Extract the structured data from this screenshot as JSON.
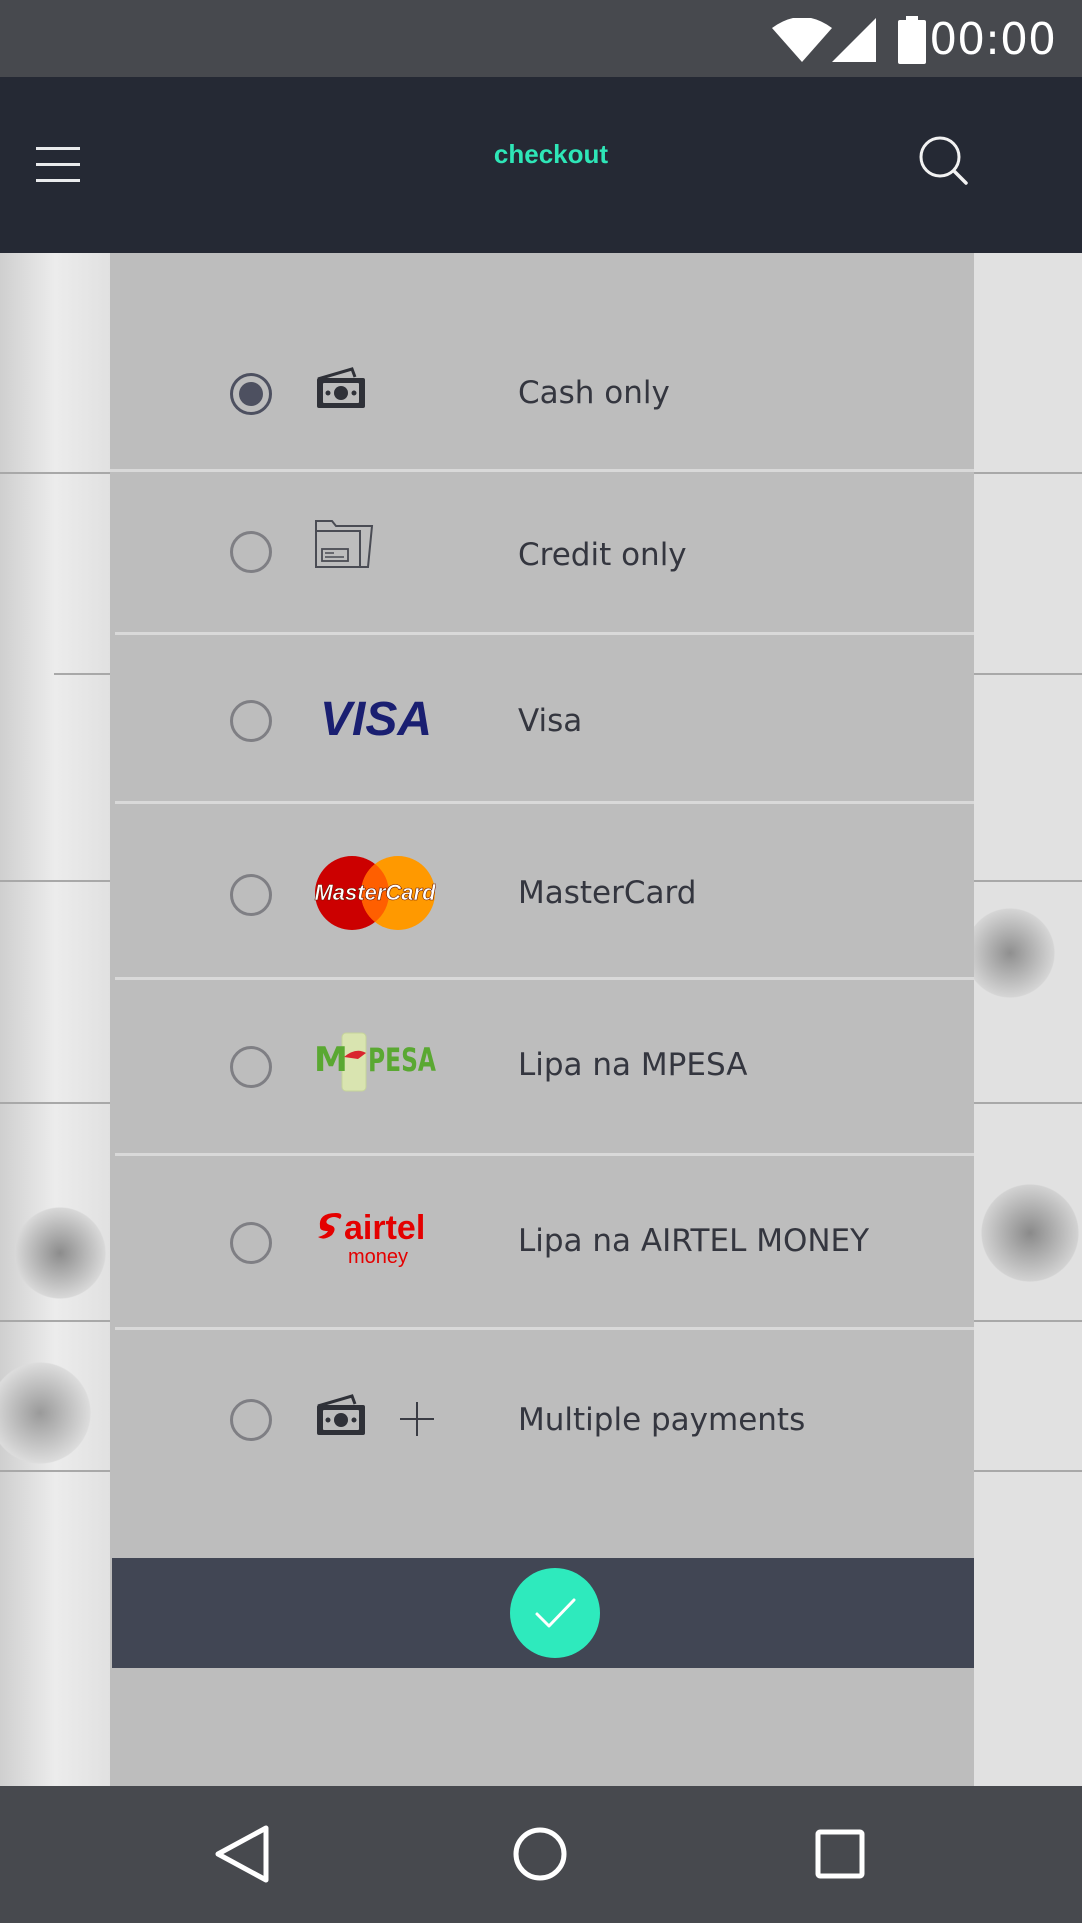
{
  "status_bar": {
    "time": "00:00",
    "icons": [
      "wifi-icon",
      "signal-icon",
      "battery-icon"
    ]
  },
  "app_bar": {
    "title": "checkout",
    "menu_icon": "hamburger-menu-icon",
    "search_icon": "search-icon",
    "title_color": "#2ee6b7"
  },
  "payment_options": [
    {
      "label": "Cash only",
      "icon": "cash-icon",
      "selected": true
    },
    {
      "label": "Credit only",
      "icon": "credit-folder-icon",
      "selected": false
    },
    {
      "label": "Visa",
      "icon": "visa-logo",
      "logo_text": "VISA",
      "selected": false
    },
    {
      "label": "MasterCard",
      "icon": "mastercard-logo",
      "logo_text": "MasterCard",
      "selected": false
    },
    {
      "label": "Lipa na MPESA",
      "icon": "mpesa-logo",
      "logo_text_left": "M",
      "logo_text_right": "PESA",
      "selected": false
    },
    {
      "label": "Lipa na AIRTEL MONEY",
      "icon": "airtel-money-logo",
      "logo_text_top": "airtel",
      "logo_text_bottom": "money",
      "selected": false
    },
    {
      "label": "Multiple payments",
      "icon": "cash-plus-icon",
      "selected": false
    }
  ],
  "confirm": {
    "icon": "checkmark-icon",
    "color": "#2eeabd"
  },
  "nav_bar": {
    "icons": [
      "back-icon",
      "home-icon",
      "recents-icon"
    ]
  }
}
